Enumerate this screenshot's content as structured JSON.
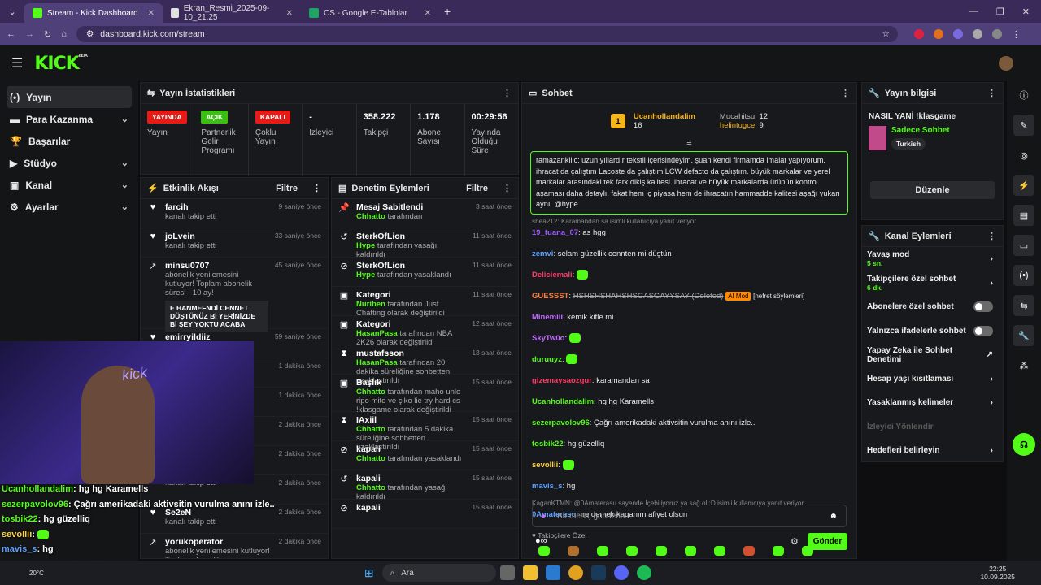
{
  "browser": {
    "tabs": [
      {
        "label": "Stream - Kick Dashboard",
        "color": "#53fc18"
      },
      {
        "label": "Ekran_Resmi_2025-09-10_21.25",
        "color": "#e0e0e0"
      },
      {
        "label": "CS - Google E-Tablolar",
        "color": "#1fa463"
      }
    ],
    "url": "dashboard.kick.com/stream"
  },
  "kick": {
    "logo": "KICK",
    "beta": "BETA"
  },
  "nav": [
    {
      "label": "Yayın",
      "icon": "(•)"
    },
    {
      "label": "Para Kazanma",
      "icon": "▬"
    },
    {
      "label": "Başarılar",
      "icon": "🏆"
    },
    {
      "label": "Stüdyo",
      "icon": "▶"
    },
    {
      "label": "Kanal",
      "icon": "▣"
    },
    {
      "label": "Ayarlar",
      "icon": "⚙"
    }
  ],
  "stats": {
    "title": "Yayın İstatistikleri",
    "items": [
      {
        "value": "YAYINDA",
        "label": "Yayın",
        "badge": "#e91916"
      },
      {
        "value": "AÇIK",
        "label": "Partnerlik Gelir Programı",
        "badge": "#3bbf12"
      },
      {
        "value": "KAPALI",
        "label": "Çoklu Yayın",
        "badge": "#e91916"
      },
      {
        "value": "-",
        "label": "İzleyici"
      },
      {
        "value": "358.222",
        "label": "Takipçi"
      },
      {
        "value": "1.178",
        "label": "Abone Sayısı"
      },
      {
        "value": "00:29:56",
        "label": "Yayında Olduğu Süre"
      }
    ]
  },
  "activity": {
    "title": "Etkinlik Akışı",
    "filter": "Filtre",
    "items": [
      {
        "name": "farcih",
        "desc": "kanalı takip etti",
        "time": "9 saniye önce",
        "icon": "♥"
      },
      {
        "name": "joLvein",
        "desc": "kanalı takip etti",
        "time": "33 saniye önce",
        "icon": "♥"
      },
      {
        "name": "minsu0707",
        "desc": "abonelik yenilemesini kutluyor! Toplam abonelik süresi - 10 ay!",
        "time": "45 saniye önce",
        "icon": "↗",
        "quote": "E HANMEFNDİ CENNET DÜŞTÜNÜZ Bİ YERİNİZDE Bİ ŞEY YOKTU ACABA"
      },
      {
        "name": "emirryildiiz",
        "desc": "",
        "time": "59 saniye önce",
        "icon": "♥"
      },
      {
        "name": "",
        "desc": "",
        "time": "1 dakika önce",
        "icon": ""
      },
      {
        "name": "",
        "desc": "",
        "time": "1 dakika önce",
        "icon": ""
      },
      {
        "name": "",
        "desc": "",
        "time": "2 dakika önce",
        "icon": ""
      },
      {
        "name": "",
        "desc": "",
        "time": "2 dakika önce",
        "icon": ""
      },
      {
        "name": "",
        "desc": "kanalı takip etti",
        "time": "2 dakika önce",
        "icon": ""
      },
      {
        "name": "Se2eN",
        "desc": "kanalı takip etti",
        "time": "2 dakika önce",
        "icon": "♥"
      },
      {
        "name": "yorukoperator",
        "desc": "abonelik yenilemesini kutluyor! Toplam abonelik",
        "time": "2 dakika önce",
        "icon": "↗"
      }
    ]
  },
  "moderation": {
    "title": "Denetim Eylemleri",
    "filter": "Filtre",
    "items": [
      {
        "name": "Mesaj Sabitlendi",
        "actor": "Chhatto",
        "text": "tarafından",
        "time": "3 saat önce",
        "icon": "📌"
      },
      {
        "name": "SterkOfLion",
        "actor": "Hype",
        "text": "tarafından yasağı kaldırıldı",
        "time": "11 saat önce",
        "icon": "↺"
      },
      {
        "name": "SterkOfLion",
        "actor": "Hype",
        "text": "tarafından yasaklandı",
        "time": "11 saat önce",
        "icon": "⊘"
      },
      {
        "name": "Kategori",
        "actor": "Nuriben",
        "text": "tarafından Just Chatting olarak değiştirildi",
        "time": "11 saat önce",
        "icon": "▣"
      },
      {
        "name": "Kategori",
        "actor": "HasanPasa",
        "text": "tarafından NBA 2K26 olarak değiştirildi",
        "time": "12 saat önce",
        "icon": "▣"
      },
      {
        "name": "mustafsson",
        "actor": "HasanPasa",
        "text": "tarafından 20 dakika süreliğine sohbetten uzaklaştırıldı",
        "time": "13 saat önce",
        "icon": "⧗"
      },
      {
        "name": "Başlık",
        "actor": "Chhatto",
        "text": "tarafından maho unlo ripo mito ve çiko lie try hard cs !klasgame olarak değiştirildi",
        "time": "15 saat önce",
        "icon": "▣"
      },
      {
        "name": "IAxiil",
        "actor": "Chhatto",
        "text": "tarafından 5 dakika süreliğine sohbetten uzaklaştırıldı",
        "time": "15 saat önce",
        "icon": "⧗"
      },
      {
        "name": "kapali",
        "actor": "Chhatto",
        "text": "tarafından yasaklandı",
        "time": "15 saat önce",
        "icon": "⊘"
      },
      {
        "name": "kapali",
        "actor": "Chhatto",
        "text": "tarafından yasağı kaldırıldı",
        "time": "15 saat önce",
        "icon": "↺"
      },
      {
        "name": "kapali",
        "actor": "",
        "text": "",
        "time": "15 saat önce",
        "icon": "⊘"
      }
    ]
  },
  "chat": {
    "title": "Sohbet",
    "leaders": [
      {
        "name": "Ucanhollandalim",
        "count": "16"
      },
      {
        "name": "Mucahitsu",
        "count": "12"
      },
      {
        "name": "helintugce",
        "count": "9"
      }
    ],
    "pinned": {
      "user": "ramazankilic",
      "text": "uzun yıllardır tekstil içerisindeyim. şuan kendi firmamda imalat yapıyorum. ihracat da çalıştım Lacoste da çalıştım LCW defacto da çalıştım. büyük markalar ve yerel markalar arasındaki tek fark dikiş kalitesi. ihracat ve büyük markalarda ürünün kontrol aşaması daha detaylı. fakat hem iç piyasa hem de ihracatın hammadde kalitesi aşağı yukarı aynı. @hype"
    },
    "messages": [
      {
        "reply": "shea212: Karamandan sa isimli kullanıcıya yanıt veriyor",
        "user": "19_tuana_07",
        "color": "#9b59ff",
        "text": "as hgg"
      },
      {
        "user": "zemvi",
        "color": "#5aa0ff",
        "text": "selam güzellik cennten mi düştün"
      },
      {
        "user": "Deliciemali",
        "color": "#ff3b6b",
        "text": "",
        "emote": true
      },
      {
        "user": "GUESSST",
        "color": "#ff7a3b",
        "text": "HSHSHSHAHSHSGASGAYYSAY (Deleted)",
        "tag": "AI Mod",
        "tag2": "[nefret söylemleri]"
      },
      {
        "user": "Minemiii",
        "color": "#c06bff",
        "text": "kemik kitle mi"
      },
      {
        "user": "SkyTw0o",
        "color": "#c06bff",
        "text": "",
        "emote": true
      },
      {
        "user": "duruuyz",
        "color": "#53fc18",
        "text": "",
        "emote": true
      },
      {
        "user": "gizemaysaozgur",
        "color": "#ff3b6b",
        "text": "karamandan sa"
      },
      {
        "user": "Ucanhollandalim",
        "color": "#53fc18",
        "text": "hg hg Karamells"
      },
      {
        "user": "sezerpavolov96",
        "color": "#53fc18",
        "text": "Çağrı amerikadaki aktivsitin vurulma anını izle.."
      },
      {
        "user": "tosbik22",
        "color": "#53fc18",
        "text": "hg güzelliq"
      },
      {
        "user": "sevollii",
        "color": "#ffd23b",
        "text": "",
        "emote": true
      },
      {
        "user": "mavis_s",
        "color": "#5aa0ff",
        "text": "hg"
      },
      {
        "reply": "KaganKTMN: @0Amaterasu sayende   İçebiliyoruz ya sağ ol :D isimli kullanıcıya yanıt veriyor",
        "user": "0Amaterasu",
        "color": "#5aa0ff",
        "text": "ne demek kaganım afiyet olsun"
      }
    ],
    "followers_only": "Takipçilere Özel",
    "placeholder": "Bir mesaj gönderin",
    "send": "Gönder"
  },
  "stream_info": {
    "title": "Yayın bilgisi",
    "stream_title": "NASIL YANİ !klasgame",
    "category": "Sadece Sohbet",
    "tag": "Turkish",
    "edit": "Düzenle"
  },
  "channel_actions": {
    "title": "Kanal Eylemleri",
    "items": [
      {
        "label": "Yavaş mod",
        "sub": "5 sn.",
        "type": "chev"
      },
      {
        "label": "Takipçilere özel sohbet",
        "sub": "6 dk.",
        "type": "chev"
      },
      {
        "label": "Abonelere özel sohbet",
        "sub": "",
        "type": "toggle"
      },
      {
        "label": "Yalnızca ifadelerle sohbet",
        "sub": "",
        "type": "toggle"
      },
      {
        "label": "Yapay Zeka ile Sohbet Denetimi",
        "sub": "",
        "type": "ext"
      },
      {
        "label": "Hesap yaşı kısıtlaması",
        "sub": "",
        "type": "chev"
      },
      {
        "label": "Yasaklanmış kelimeler",
        "sub": "",
        "type": "chev"
      },
      {
        "label": "İzleyici Yönlendir",
        "sub": "",
        "type": "disabled"
      },
      {
        "label": "Hedefleri belirleyin",
        "sub": "",
        "type": "chev"
      }
    ]
  },
  "overlay": [
    {
      "user": "Ucanhollandalim",
      "color": "#53fc18",
      "text": "hg hg Karamells"
    },
    {
      "user": "sezerpavolov96",
      "color": "#53fc18",
      "text": "Çağrı amerikadaki aktivsitin vurulma anını izle.."
    },
    {
      "user": "tosbik22",
      "color": "#53fc18",
      "text": "hg güzelliq"
    },
    {
      "user": "sevollii",
      "color": "#ffd23b",
      "text": ""
    },
    {
      "user": "mavis_s",
      "color": "#5aa0ff",
      "text": "hg"
    },
    {
      "user": "0Amaterasu",
      "color": "#5aa0ff",
      "text": "ne demek kaganım afiyet olsun"
    }
  ],
  "taskbar": {
    "search": "Ara",
    "time": "22:25",
    "date": "10.09.2025",
    "weather": "20°C"
  }
}
